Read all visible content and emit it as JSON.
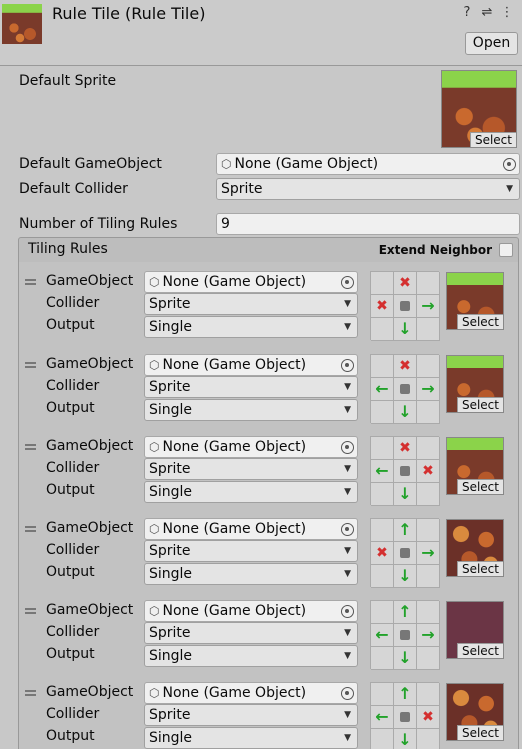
{
  "header": {
    "title": "Rule Tile (Rule Tile)",
    "open_label": "Open",
    "icons": [
      "help-icon",
      "presets-icon",
      "more-icon"
    ]
  },
  "default_sprite": {
    "label": "Default Sprite",
    "select_label": "Select"
  },
  "default_gameobject": {
    "label": "Default GameObject",
    "value": "None (Game Object)"
  },
  "default_collider": {
    "label": "Default Collider",
    "value": "Sprite"
  },
  "tiling_count": {
    "label": "Number of Tiling Rules",
    "value": "9"
  },
  "tiling_rules": {
    "title": "Tiling Rules",
    "extend_neighbor_label": "Extend Neighbor",
    "extend_neighbor_checked": false
  },
  "rule_labels": {
    "gameobject": "GameObject",
    "collider": "Collider",
    "output": "Output",
    "select": "Select"
  },
  "rules": [
    {
      "gameobject": "None (Game Object)",
      "collider": "Sprite",
      "output": "Single",
      "sprite": "grass-top-tile",
      "neighbors": [
        "",
        "x",
        "",
        "x",
        "c",
        "g",
        "",
        "g",
        ""
      ]
    },
    {
      "gameobject": "None (Game Object)",
      "collider": "Sprite",
      "output": "Single",
      "sprite": "grass-top-tile",
      "neighbors": [
        "",
        "x",
        "",
        "g",
        "c",
        "g",
        "",
        "g",
        ""
      ]
    },
    {
      "gameobject": "None (Game Object)",
      "collider": "Sprite",
      "output": "Single",
      "sprite": "grass-top-tile",
      "neighbors": [
        "",
        "x",
        "",
        "g",
        "c",
        "x",
        "",
        "g",
        ""
      ]
    },
    {
      "gameobject": "None (Game Object)",
      "collider": "Sprite",
      "output": "Single",
      "sprite": "dirt-tile",
      "neighbors": [
        "",
        "g",
        "",
        "x",
        "c",
        "g",
        "",
        "g",
        ""
      ]
    },
    {
      "gameobject": "None (Game Object)",
      "collider": "Sprite",
      "output": "Single",
      "sprite": "plain-tile",
      "neighbors": [
        "",
        "g",
        "",
        "g",
        "c",
        "g",
        "",
        "g",
        ""
      ]
    },
    {
      "gameobject": "None (Game Object)",
      "collider": "Sprite",
      "output": "Single",
      "sprite": "dirt-tile",
      "neighbors": [
        "",
        "g",
        "",
        "g",
        "c",
        "x",
        "",
        "g",
        ""
      ]
    }
  ]
}
